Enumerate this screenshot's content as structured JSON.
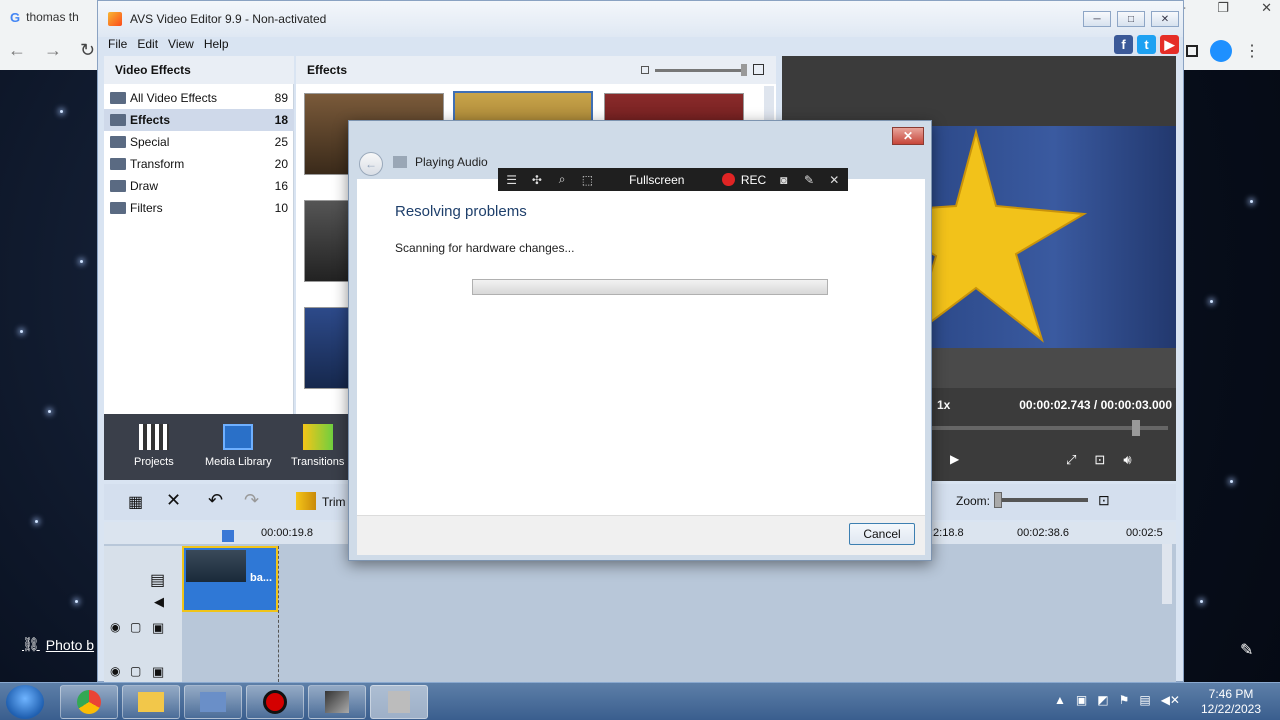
{
  "browser": {
    "tab_title": "thomas th",
    "photo_credit": "Photo b"
  },
  "app": {
    "title": "AVS Video Editor 9.9 - Non-activated",
    "menu": [
      "File",
      "Edit",
      "View",
      "Help"
    ]
  },
  "left_panel": {
    "title": "Video Effects",
    "categories": [
      {
        "label": "All Video Effects",
        "count": "89"
      },
      {
        "label": "Effects",
        "count": "18"
      },
      {
        "label": "Special",
        "count": "25"
      },
      {
        "label": "Transform",
        "count": "20"
      },
      {
        "label": "Draw",
        "count": "16"
      },
      {
        "label": "Filters",
        "count": "10"
      }
    ]
  },
  "effects": {
    "title": "Effects"
  },
  "toolbar": {
    "projects": "Projects",
    "media_library": "Media Library",
    "transitions": "Transitions",
    "trim": "Trim",
    "zoom": "Zoom:"
  },
  "preview": {
    "speed": "1x",
    "time_current": "00:00:02.743",
    "time_sep": "/",
    "time_total": "00:00:03.000"
  },
  "timeline": {
    "marks": [
      "00:00:19.8",
      ":2:18.8",
      "00:02:38.6",
      "00:02:5"
    ],
    "clip_label": "ba..."
  },
  "dialog": {
    "nav_title": "Playing Audio",
    "heading": "Resolving problems",
    "status": "Scanning for hardware changes...",
    "progress": 0,
    "cancel": "Cancel"
  },
  "rec_bar": {
    "fullscreen": "Fullscreen",
    "rec": "REC"
  },
  "taskbar": {
    "time": "7:46 PM",
    "date": "12/22/2023"
  }
}
